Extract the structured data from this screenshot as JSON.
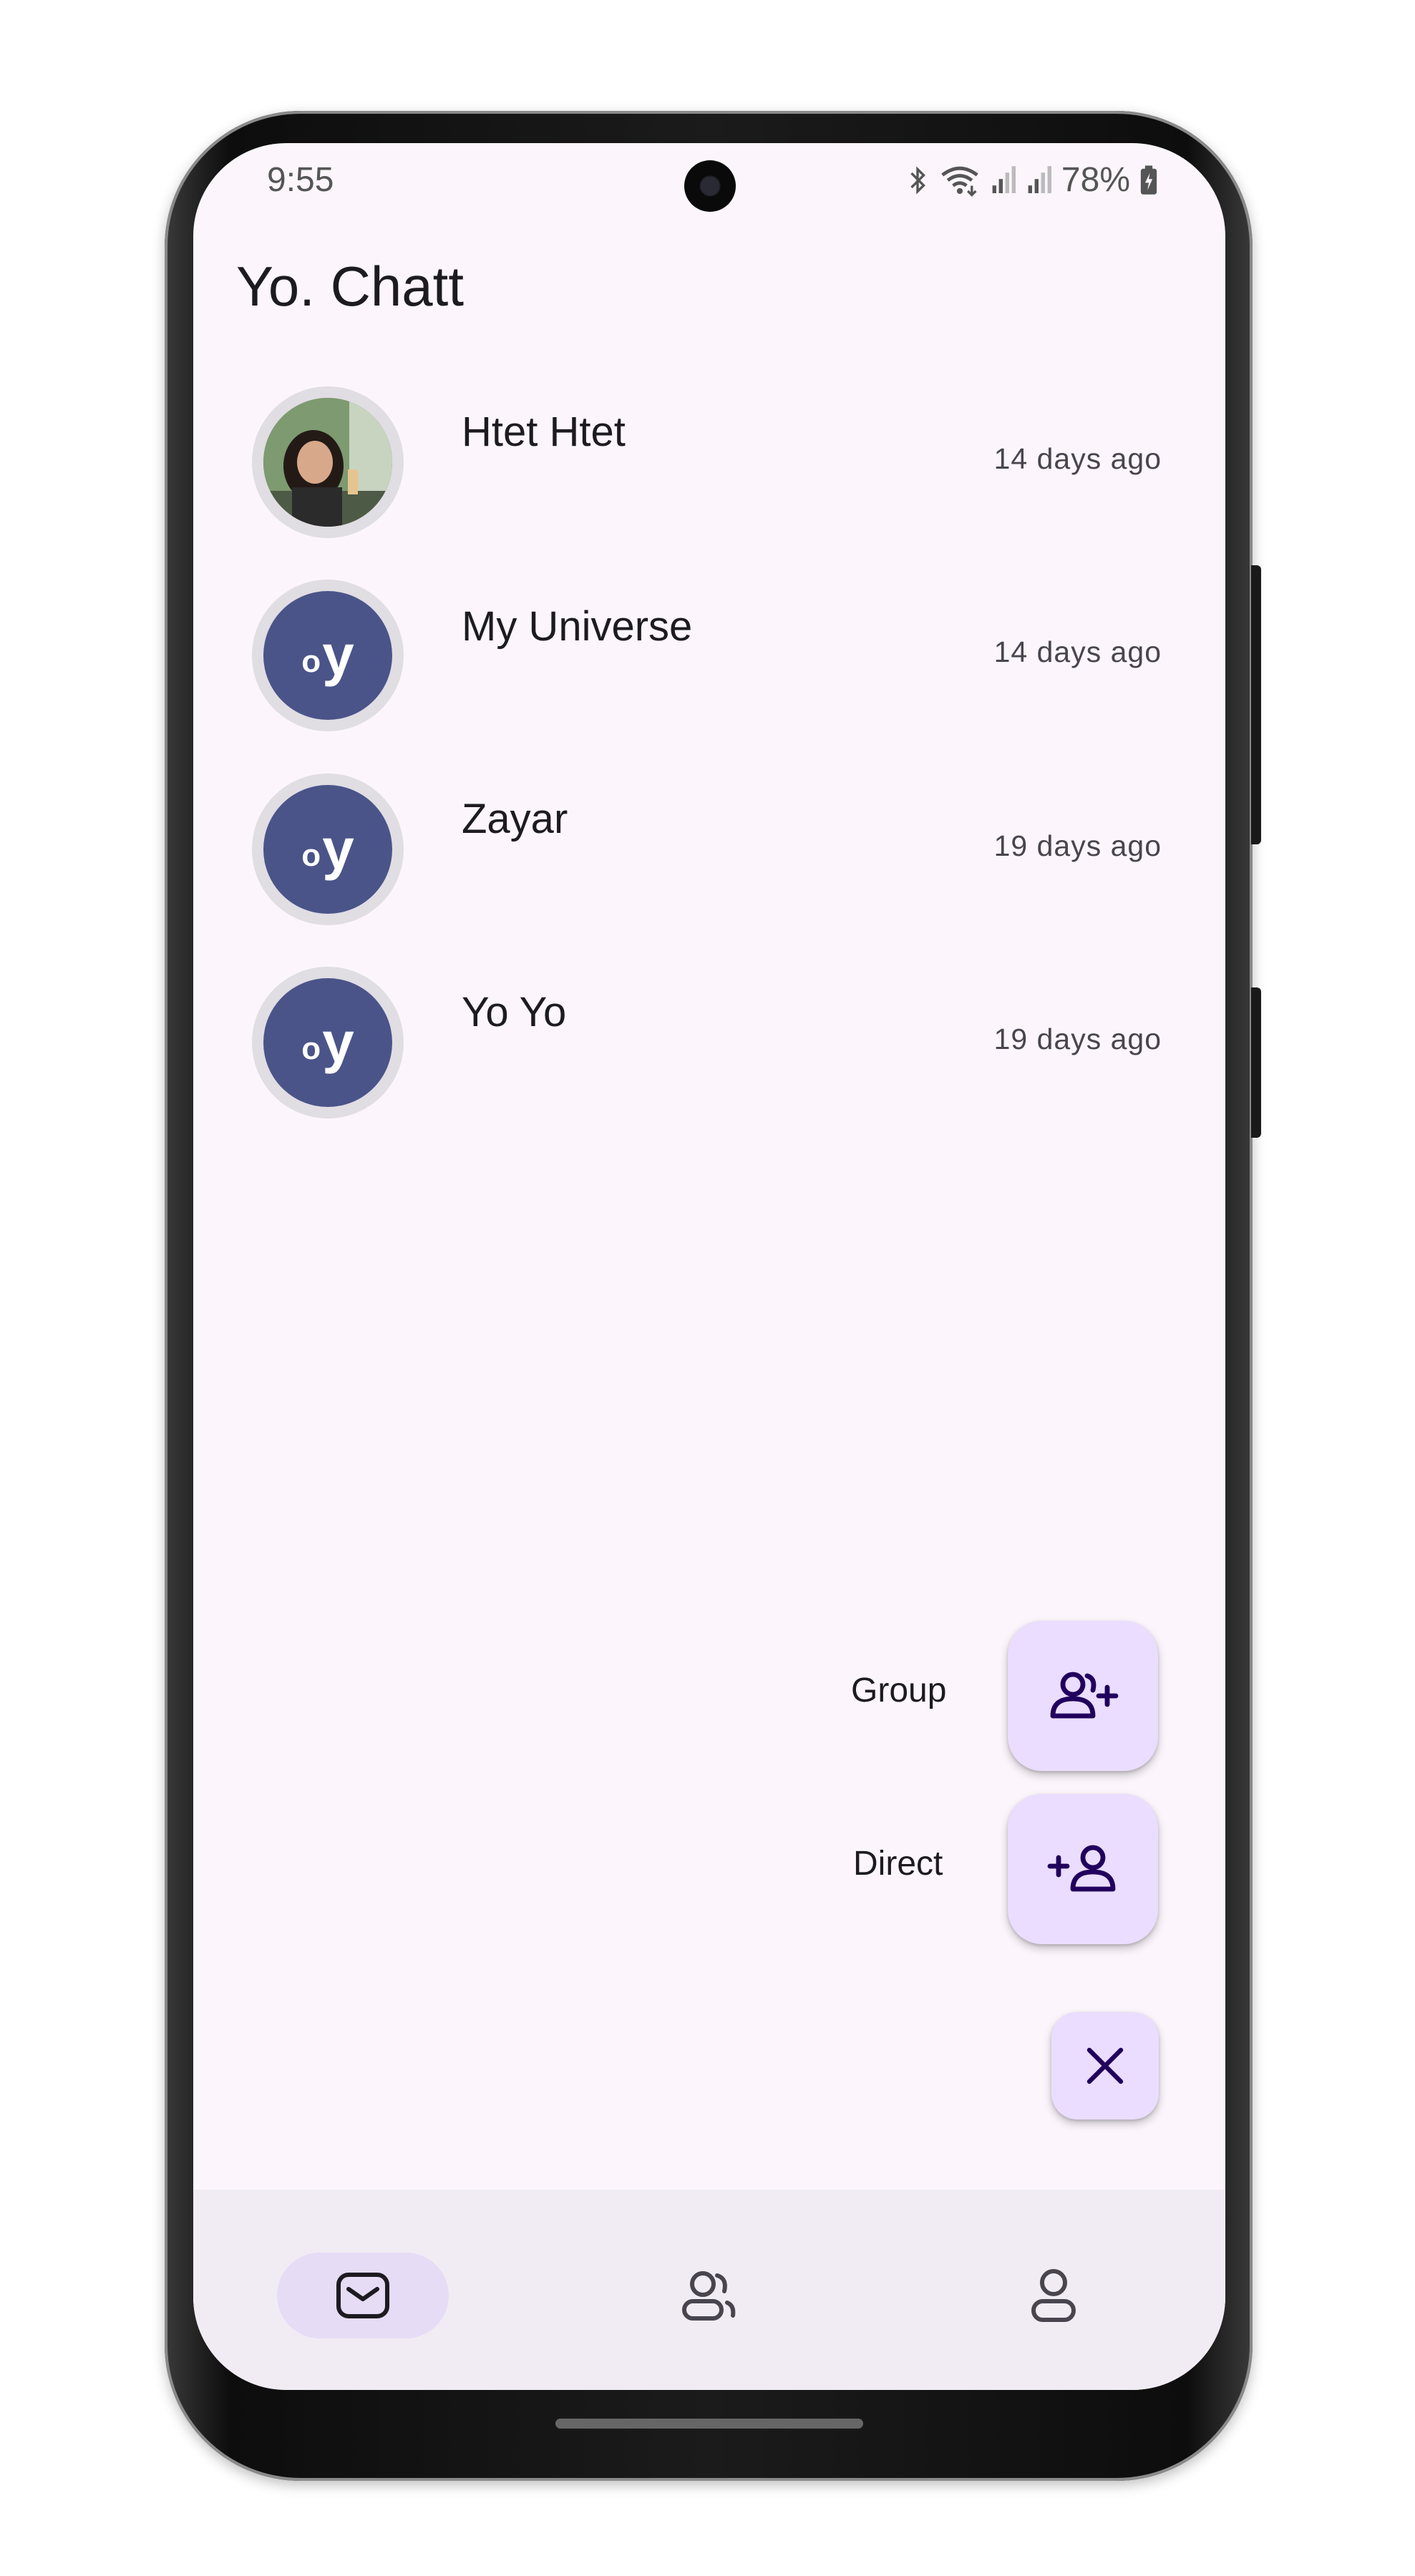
{
  "status_bar": {
    "time": "9:55",
    "battery": "78%",
    "icons": [
      "bluetooth-icon",
      "wifi-icon",
      "signal-icon",
      "signal-icon",
      "battery-icon"
    ]
  },
  "app": {
    "title": "Yo. Chatt"
  },
  "chats": [
    {
      "name": "Htet Htet",
      "time": "14 days ago",
      "avatar": "photo"
    },
    {
      "name": "My Universe",
      "time": "14 days ago",
      "avatar": "logo"
    },
    {
      "name": "Zayar",
      "time": "19 days ago",
      "avatar": "logo"
    },
    {
      "name": "Yo Yo",
      "time": "19 days ago",
      "avatar": "logo"
    }
  ],
  "logo_text": {
    "small": "o",
    "big": "y"
  },
  "fab_menu": {
    "group_label": "Group",
    "direct_label": "Direct",
    "icons": [
      "group-add-icon",
      "person-add-icon",
      "close-icon"
    ]
  },
  "nav": {
    "items": [
      {
        "icon": "mail-icon",
        "active": true
      },
      {
        "icon": "contacts-icon",
        "active": false
      },
      {
        "icon": "profile-icon",
        "active": false
      }
    ]
  },
  "colors": {
    "background": "#fcf6fc",
    "avatar": "#4a5489",
    "fab": "#eaddff",
    "nav_active": "#e6dcf6",
    "navbar": "#f1ecf4"
  }
}
